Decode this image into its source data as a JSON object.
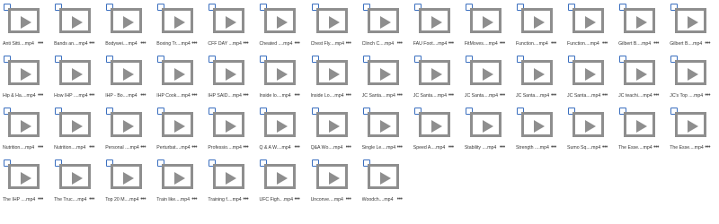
{
  "files": [
    {
      "name": "Anti Sitti...",
      "ext": ".mp4"
    },
    {
      "name": "Bands an...",
      "ext": ".mp4"
    },
    {
      "name": "Bodywei...",
      "ext": ".mp4"
    },
    {
      "name": "Boxing Tr...",
      "ext": ".mp4"
    },
    {
      "name": "CFF DAY ...",
      "ext": ".mp4"
    },
    {
      "name": "Cheated ...",
      "ext": ".mp4"
    },
    {
      "name": "Chest Fly...",
      "ext": ".mp4"
    },
    {
      "name": "Clinch C...",
      "ext": ".mp4"
    },
    {
      "name": "FAU Foot...",
      "ext": ".mp4"
    },
    {
      "name": "FitMoves...",
      "ext": ".mp4"
    },
    {
      "name": "Function...",
      "ext": ".mp4"
    },
    {
      "name": "Function...",
      "ext": ".mp4"
    },
    {
      "name": "Gilbert B...",
      "ext": ".mp4"
    },
    {
      "name": "Gilbert B...",
      "ext": ".mp4"
    },
    {
      "name": "Hip & Ha...",
      "ext": ".mp4"
    },
    {
      "name": "How IHP ...",
      "ext": ".mp4"
    },
    {
      "name": "IHP - Bo...",
      "ext": ".mp4"
    },
    {
      "name": "IHP Cook...",
      "ext": ".mp4"
    },
    {
      "name": "IHP SAID...",
      "ext": ".mp4"
    },
    {
      "name": "Inside lo...",
      "ext": ".mp4"
    },
    {
      "name": "Inside Lo...",
      "ext": ".mp4"
    },
    {
      "name": "JC Santa...",
      "ext": ".mp4"
    },
    {
      "name": "JC Santa...",
      "ext": ".mp4"
    },
    {
      "name": "JC Santa...",
      "ext": ".mp4"
    },
    {
      "name": "JC Santa...",
      "ext": ".mp4"
    },
    {
      "name": "JC Santa...",
      "ext": ".mp4"
    },
    {
      "name": "JC teachi...",
      "ext": ".mp4"
    },
    {
      "name": "JC's Top ...",
      "ext": ".mp4"
    },
    {
      "name": "Nutrition...",
      "ext": ".mp4"
    },
    {
      "name": "Nutrition...",
      "ext": ".mp4"
    },
    {
      "name": "Personal ...",
      "ext": ".mp4"
    },
    {
      "name": "Perturbat...",
      "ext": ".mp4"
    },
    {
      "name": "Professio...",
      "ext": ".mp4"
    },
    {
      "name": "Q & A W...",
      "ext": ".mp4"
    },
    {
      "name": "Q&A Wo...",
      "ext": ".mp4"
    },
    {
      "name": "Single Le...",
      "ext": ".mp4"
    },
    {
      "name": "Speed A...",
      "ext": ".mp4"
    },
    {
      "name": "Stability ...",
      "ext": ".mp4"
    },
    {
      "name": "Strength ...",
      "ext": ".mp4"
    },
    {
      "name": "Sumo Sq...",
      "ext": ".mp4"
    },
    {
      "name": "The Esse...",
      "ext": ".mp4"
    },
    {
      "name": "The Esse...",
      "ext": ".mp4"
    },
    {
      "name": "The IHP ...",
      "ext": ".mp4"
    },
    {
      "name": "The Truc...",
      "ext": ".mp4"
    },
    {
      "name": "Top 20 M...",
      "ext": ".mp4"
    },
    {
      "name": "Train like...",
      "ext": ".mp4"
    },
    {
      "name": "Training f...",
      "ext": ".mp4"
    },
    {
      "name": "UFC Figh...",
      "ext": ".mp4"
    },
    {
      "name": "Unconve...",
      "ext": ".mp4"
    },
    {
      "name": "Woodch...",
      "ext": ".mp4"
    }
  ],
  "more_menu_glyph": "•••",
  "colors": {
    "checkbox_border": "#3b6fbf",
    "thumbnail": "#8e8e8e",
    "background": "#ffffff"
  }
}
